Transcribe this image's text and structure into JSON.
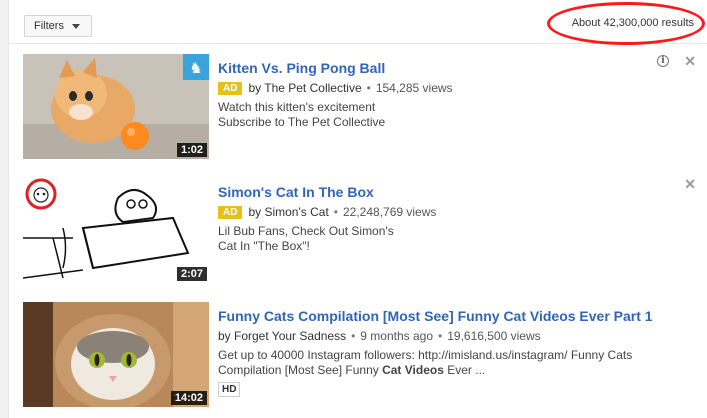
{
  "filters": {
    "label": "Filters"
  },
  "results_count": "About 42,300,000 results",
  "results": [
    {
      "title": "Kitten Vs. Ping Pong Ball",
      "ad": "AD",
      "channel": "by The Pet Collective",
      "views": "154,285 views",
      "desc_line1": "Watch this kitten's excitement",
      "desc_line2": "Subscribe to The Pet Collective",
      "duration": "1:02"
    },
    {
      "title": "Simon's Cat In The Box",
      "ad": "AD",
      "channel": "by Simon's Cat",
      "views": "22,248,769 views",
      "desc_line1": "Lil Bub Fans, Check Out Simon's",
      "desc_line2": "Cat In \"The Box\"!",
      "duration": "2:07"
    },
    {
      "title": "Funny Cats Compilation [Most See] Funny Cat Videos Ever Part 1",
      "channel": "by Forget Your Sadness",
      "age": "9 months ago",
      "views": "19,616,500 views",
      "desc_line1": "Get up to 40000 Instagram followers: http://imisland.us/instagram/ Funny Cats",
      "desc_line2_pre": "Compilation [Most See] Funny ",
      "desc_line2_bold": "Cat Videos",
      "desc_line2_post": " Ever ...",
      "hd": "HD",
      "duration": "14:02"
    }
  ],
  "icons": {
    "close": "✕",
    "info": "i"
  },
  "colors": {
    "title_link": "#2f66b9",
    "ad_badge": "#e6c11b",
    "highlight": "#ff1a1a"
  }
}
